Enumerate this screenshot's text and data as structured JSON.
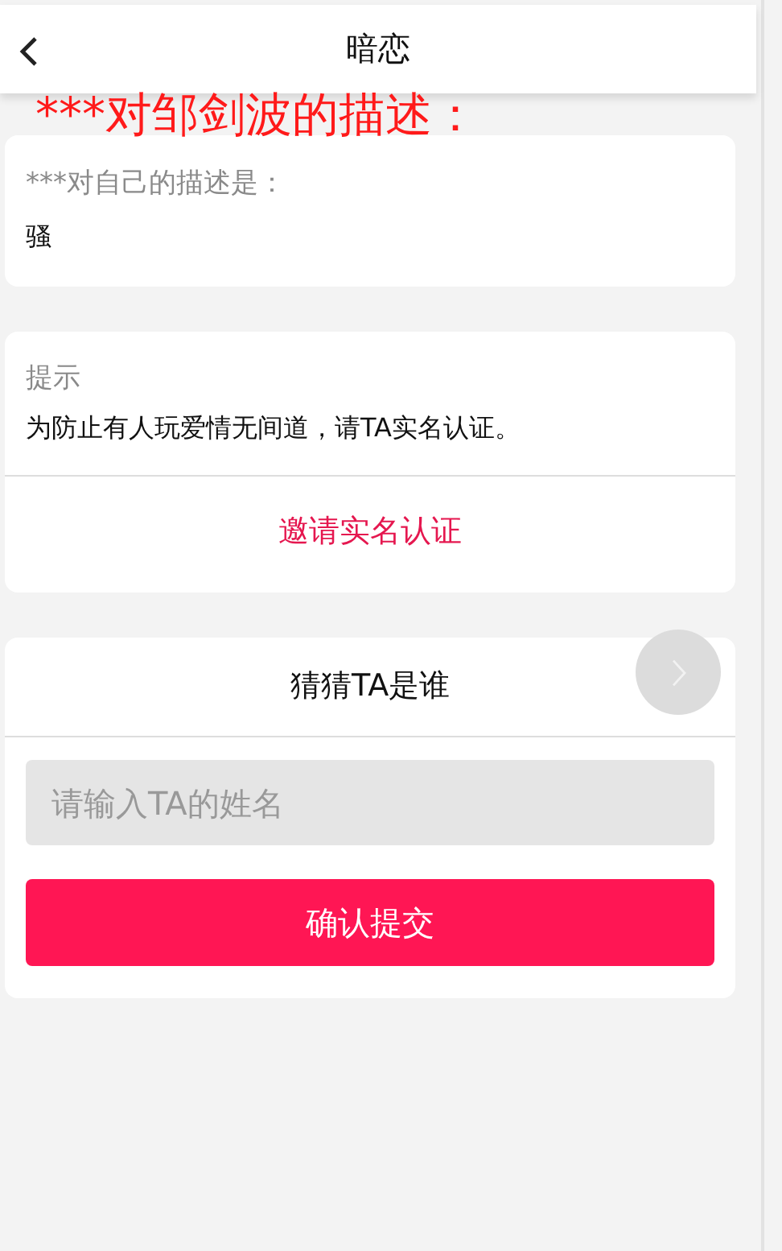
{
  "header": {
    "title": "暗恋"
  },
  "overlay_caption": "***对邹剑波的描述：",
  "self_description": {
    "label": "***对自己的描述是：",
    "value": "骚"
  },
  "notice": {
    "label": "提示",
    "message": "为防止有人玩爱情无间道，请TA实名认证。",
    "action": "邀请实名认证"
  },
  "guess": {
    "title": "猜猜TA是谁",
    "placeholder": "请输入TA的姓名",
    "submit": "确认提交"
  }
}
